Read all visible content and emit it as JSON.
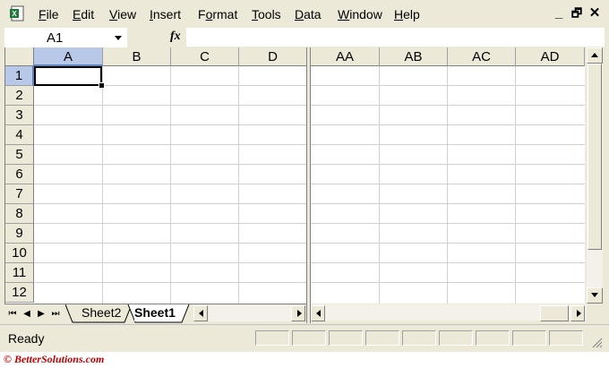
{
  "menu": {
    "items": [
      {
        "pre": "",
        "acc": "F",
        "post": "ile"
      },
      {
        "pre": "",
        "acc": "E",
        "post": "dit"
      },
      {
        "pre": "",
        "acc": "V",
        "post": "iew"
      },
      {
        "pre": "",
        "acc": "I",
        "post": "nsert"
      },
      {
        "pre": "F",
        "acc": "o",
        "post": "rmat"
      },
      {
        "pre": "",
        "acc": "T",
        "post": "ools"
      },
      {
        "pre": "",
        "acc": "D",
        "post": "ata"
      },
      {
        "pre": "",
        "acc": "W",
        "post": "indow"
      },
      {
        "pre": "",
        "acc": "H",
        "post": "elp"
      }
    ],
    "controls": {
      "minimize": "_",
      "restore": "🗗",
      "close": "✕"
    }
  },
  "formula_bar": {
    "name_box": "A1",
    "fx": "fx",
    "formula": ""
  },
  "left_pane": {
    "columns": [
      "A",
      "B",
      "C",
      "D"
    ],
    "rows": [
      "1",
      "2",
      "3",
      "4",
      "5",
      "6",
      "7",
      "8",
      "9",
      "10",
      "11",
      "12"
    ],
    "active_column": "A",
    "active_row": "1"
  },
  "right_pane": {
    "columns": [
      "AA",
      "AB",
      "AC",
      "AD"
    ]
  },
  "sheet_tabs": {
    "tabs": [
      "Sheet2",
      "Sheet1"
    ],
    "active": "Sheet1",
    "nav": [
      "⏮",
      "◀",
      "▶",
      "⏭"
    ]
  },
  "status": {
    "text": "Ready"
  },
  "copyright": "© BetterSolutions.com",
  "colors": {
    "excel_green": "#1e7a3a",
    "selection_header": "#b8c8e8",
    "chrome": "#ece9d8",
    "watermark": "#c00000"
  }
}
